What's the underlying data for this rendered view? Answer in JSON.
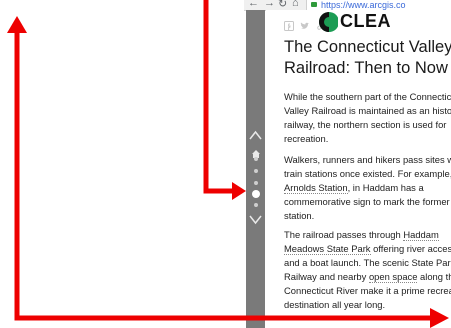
{
  "browser": {
    "nav_icons": [
      "back-icon",
      "forward-icon",
      "home-icon"
    ],
    "url": "https://www.arcgis.co"
  },
  "rail": {
    "up_icon": "chevron-up-icon",
    "down_icon": "chevron-down-icon",
    "home_icon": "home-icon",
    "dot_count": 5,
    "active_dot_index": 3
  },
  "header": {
    "share_icons": [
      "facebook-icon",
      "twitter-icon",
      "link-icon"
    ],
    "logo_text": "CLEA",
    "title_line1": "The Connecticut Valley",
    "title_line2": "Railroad: Then to Now"
  },
  "paragraphs": {
    "p1": {
      "l1": "While the southern part of the Connecticut",
      "l2": "Valley Railroad is maintained as an historic",
      "l3": "railway, the northern section is used for",
      "l4": "recreation."
    },
    "p2": {
      "l1": "Walkers, runners and hikers pass sites whe",
      "l2": "train stations once existed. For example,",
      "l3_link": "Arnolds Station",
      "l3_rest": ", in Haddam has a",
      "l4": "commemorative sign to mark the former",
      "l5": "station."
    },
    "p3": {
      "l1_pre": "The railroad passes through ",
      "l1_link": "Haddam",
      "l2_link": "Meadows State Park",
      "l2_rest": " offering river access",
      "l3": "and a boat launch. The scenic State Park Tr",
      "l4_pre": "Railway and nearby ",
      "l4_link": "open space",
      "l4_rest": " along the",
      "l5": "Connecticut River make it a prime recreati",
      "l6": "destination all year long."
    }
  },
  "colors": {
    "annotation_red": "#ee0000",
    "rail_grey": "#7a7a7a",
    "logo_green": "#1c9c54"
  }
}
